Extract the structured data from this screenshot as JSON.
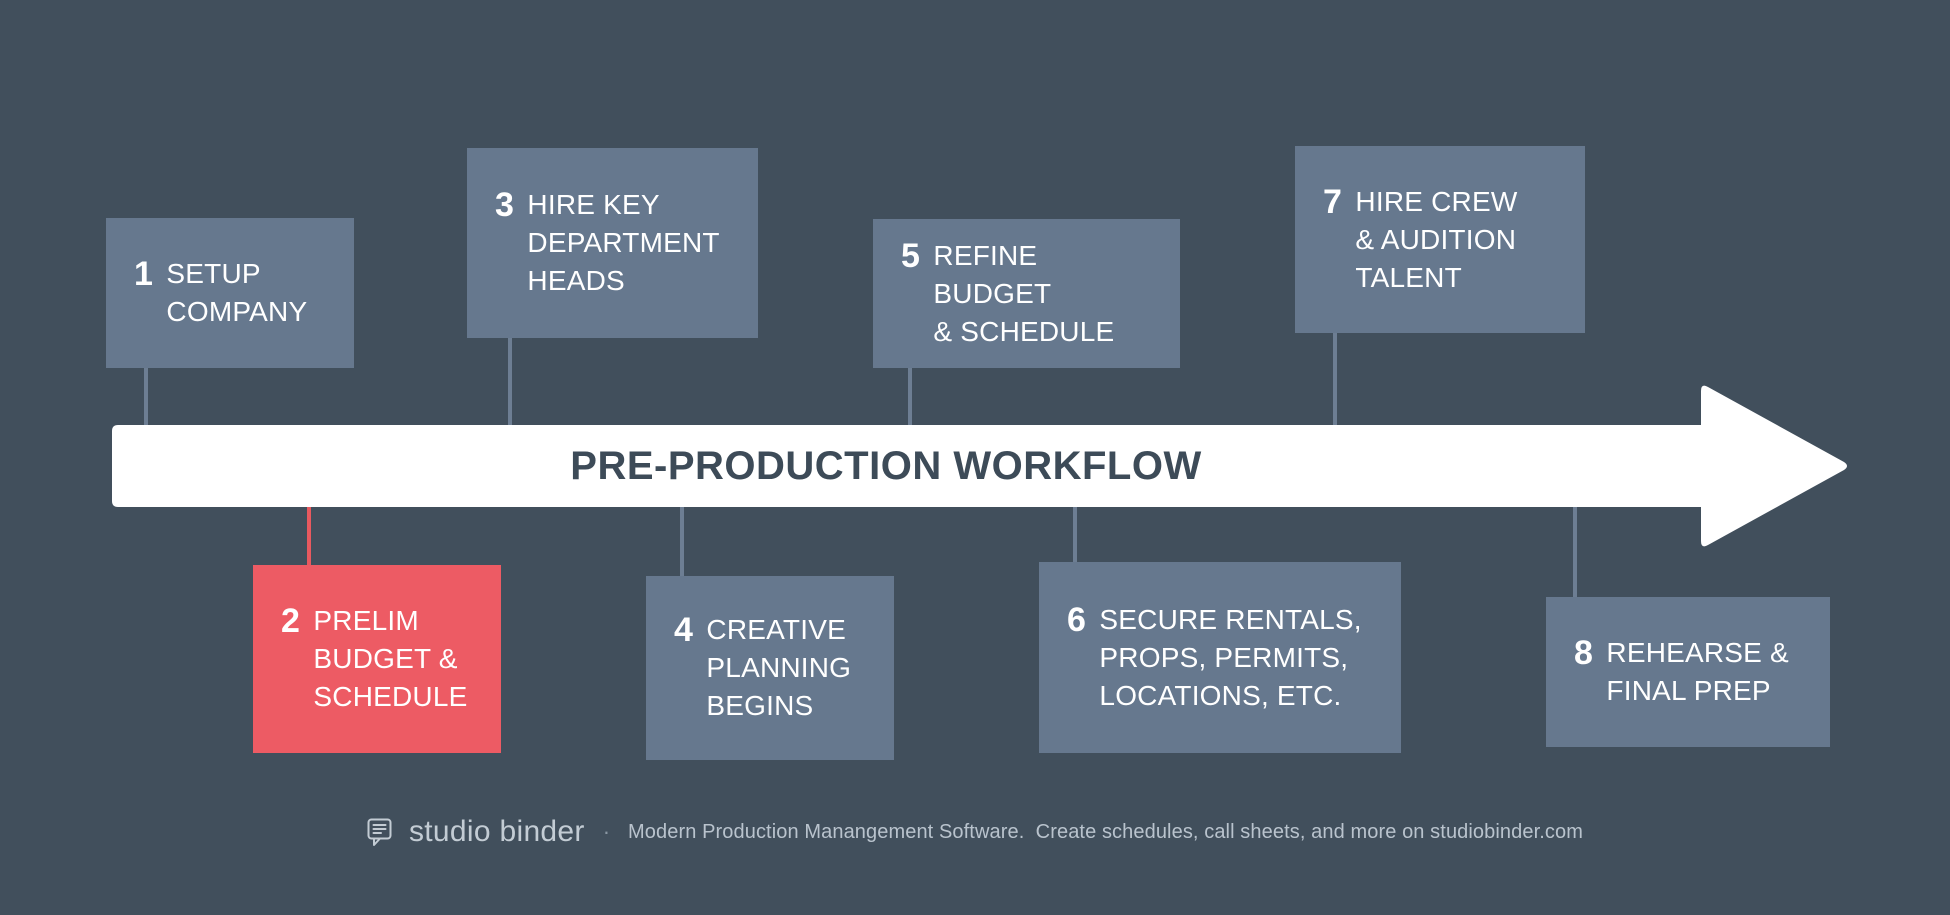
{
  "banner": {
    "title": "PRE-PRODUCTION WORKFLOW",
    "arrow_color": "#ffffff",
    "title_color": "#3d4b58"
  },
  "theme": {
    "background": "#414f5c",
    "box_fill": "#66788e",
    "accent_fill": "#ed5b64",
    "connector": "#6d7e93",
    "text": "#ffffff"
  },
  "steps": [
    {
      "number": "1",
      "label": "SETUP\nCOMPANY",
      "position": "above",
      "highlight": false
    },
    {
      "number": "2",
      "label": "PRELIM\nBUDGET &\nSCHEDULE",
      "position": "below",
      "highlight": true
    },
    {
      "number": "3",
      "label": "HIRE KEY\nDEPARTMENT\nHEADS",
      "position": "above",
      "highlight": false
    },
    {
      "number": "4",
      "label": "CREATIVE\nPLANNING\nBEGINS",
      "position": "below",
      "highlight": false
    },
    {
      "number": "5",
      "label": "REFINE BUDGET\n& SCHEDULE",
      "position": "above",
      "highlight": false
    },
    {
      "number": "6",
      "label": "SECURE RENTALS,\nPROPS, PERMITS,\nLOCATIONS, ETC.",
      "position": "below",
      "highlight": false
    },
    {
      "number": "7",
      "label": "HIRE CREW\n& AUDITION\nTALENT",
      "position": "above",
      "highlight": false
    },
    {
      "number": "8",
      "label": "REHEARSE &\nFINAL PREP",
      "position": "below",
      "highlight": false
    }
  ],
  "footer": {
    "logo_icon": "speech-bubble-icon",
    "logo_text": "studio binder",
    "separator": "·",
    "tagline": "Modern Production Manangement Software.  Create schedules, call sheets, and more on studiobinder.com"
  }
}
